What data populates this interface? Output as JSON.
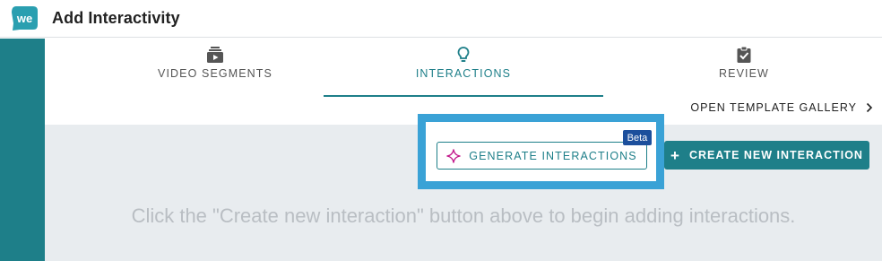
{
  "header": {
    "logo_text": "we",
    "title": "Add Interactivity"
  },
  "tabs": [
    {
      "label": "VIDEO SEGMENTS",
      "icon": "video-segments-icon",
      "active": false
    },
    {
      "label": "INTERACTIONS",
      "icon": "lightbulb-icon",
      "active": true
    },
    {
      "label": "REVIEW",
      "icon": "clipboard-check-icon",
      "active": false
    }
  ],
  "gallery": {
    "label": "OPEN TEMPLATE GALLERY",
    "icon": "chevron-right-icon"
  },
  "actions": {
    "generate_label": "GENERATE INTERACTIONS",
    "generate_icon": "sparkle-icon",
    "beta_label": "Beta",
    "create_label": "CREATE NEW INTERACTION",
    "create_icon": "plus-icon"
  },
  "empty_state": {
    "message": "Click the \"Create new interaction\" button above to begin adding interactions."
  },
  "colors": {
    "brand_teal": "#1e7f89",
    "highlight_blue": "#3aa2d6",
    "beta_blue": "#1c4f9c",
    "sparkle_magenta": "#c2188b",
    "content_bg": "#e8ecef"
  }
}
